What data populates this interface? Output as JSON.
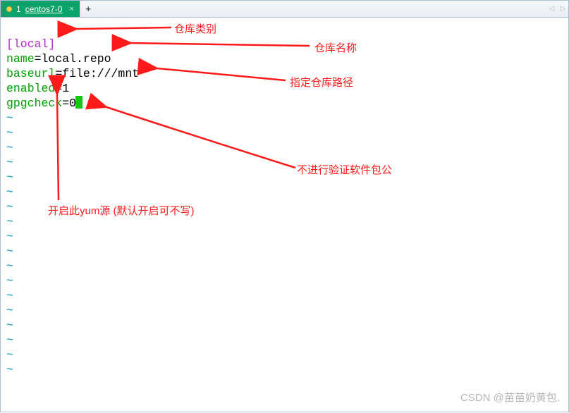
{
  "tabbar": {
    "active_tab_index": "1",
    "active_tab_label": "centos7-0",
    "new_tab_glyph": "+",
    "nav_left": "◁",
    "nav_right": "▷"
  },
  "editor": {
    "l1_bracket_open": "[",
    "l1_section": "local",
    "l1_bracket_close": "]",
    "l2_key": "name",
    "l2_eq": "=",
    "l2_val": "local.repo",
    "l3_key": "baseurl",
    "l3_eq": "=",
    "l3_val": "file:///mnt",
    "l4_key": "enabled",
    "l4_eq": "=",
    "l4_val": "1",
    "l5_key": "gpgcheck",
    "l5_eq": "=",
    "l5_val": "0",
    "tilde": "~",
    "tilde_count": 18
  },
  "annotations": {
    "a1": "仓库类别",
    "a2": "仓库名称",
    "a3": "指定仓库路径",
    "a4": "开启此yum源   (默认开启可不写)",
    "a5": "不进行验证软件包公"
  },
  "watermark": "CSDN @苗苗奶黄包."
}
